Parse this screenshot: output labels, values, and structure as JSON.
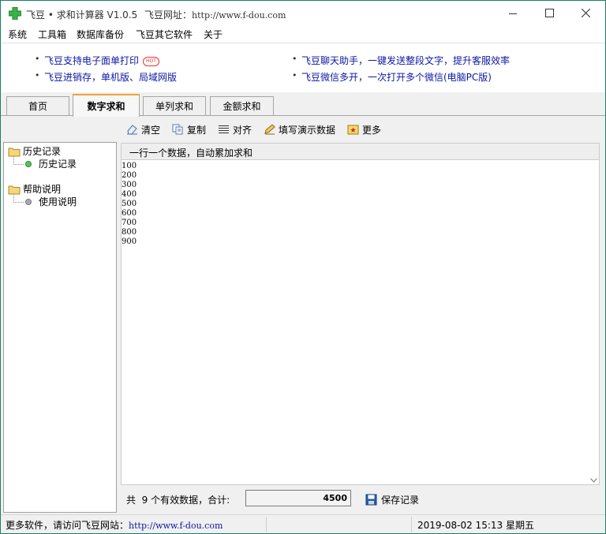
{
  "window": {
    "title": "飞豆 • 求和计算器 V1.0.5",
    "url_label": "飞豆网址：",
    "url": "http://www.f-dou.com"
  },
  "menu": [
    "系统",
    "工具箱",
    "数据库备份",
    "飞豆其它软件",
    "关于"
  ],
  "ads": {
    "left": [
      "飞豆支持电子面单打印",
      "飞豆进销存，单机版、局域网版"
    ],
    "hot_badge": "HOT",
    "right": [
      "飞豆聊天助手，一键发送整段文字，提升客服效率",
      "飞豆微信多开，一次打开多个微信(电脑PC版)"
    ]
  },
  "tabs": [
    {
      "label": "首页",
      "active": false
    },
    {
      "label": "数字求和",
      "active": true
    },
    {
      "label": "单列求和",
      "active": false
    },
    {
      "label": "金额求和",
      "active": false
    }
  ],
  "toolbar": {
    "clear": "清空",
    "copy": "复制",
    "align": "对齐",
    "demo": "填写演示数据",
    "more": "更多"
  },
  "tree": {
    "history_folder": "历史记录",
    "history_item": "历史记录",
    "help_folder": "帮助说明",
    "help_item": "使用说明"
  },
  "editor": {
    "header": "一行一个数据，自动累加求和",
    "lines": [
      "100",
      "200",
      "300",
      "400",
      "500",
      "600",
      "700",
      "800",
      "900"
    ]
  },
  "summary": {
    "text": "共  9 个有效数据，合计:",
    "total": "4500",
    "save": "保存记录"
  },
  "status": {
    "visit_text": "更多软件，请访问飞豆网站：",
    "url": "http://www.f-dou.com",
    "datetime": "2019-08-02 15:13 星期五"
  },
  "colors": {
    "border": "#1a7f64",
    "link": "#0b17a6",
    "active_tab_accent": "#f2a23a"
  }
}
